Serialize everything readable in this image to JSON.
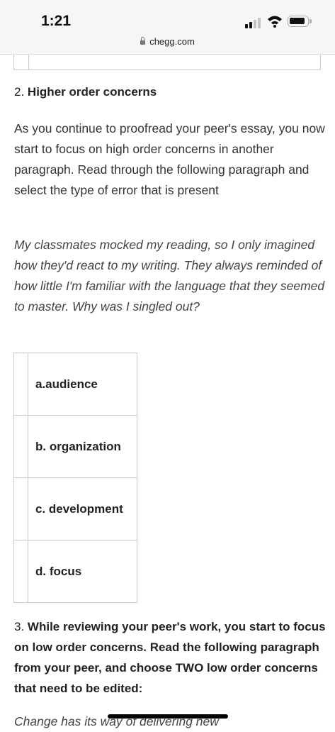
{
  "status_bar": {
    "time": "1:21",
    "url": "chegg.com"
  },
  "question2": {
    "number": "2.",
    "title": "Higher order concerns",
    "intro": "As you continue to proofread your peer's essay, you now start to focus on high order concerns in another paragraph. Read through the following paragraph and select the type of error that is present",
    "excerpt": "My classmates mocked my reading, so I only imagined how they'd react to my writing. They always reminded of how little I'm familiar with the language that they seemed to master. Why was I singled out?",
    "options": [
      "a.audience",
      "b. organization",
      "c. development",
      "d. focus"
    ]
  },
  "question3": {
    "number": "3.",
    "text": "While reviewing your peer's work, you start to focus on low order concerns. Read the following paragraph from your peer, and choose TWO low order concerns that need to be edited:",
    "excerpt_start": "Change has its way of delivering new"
  }
}
